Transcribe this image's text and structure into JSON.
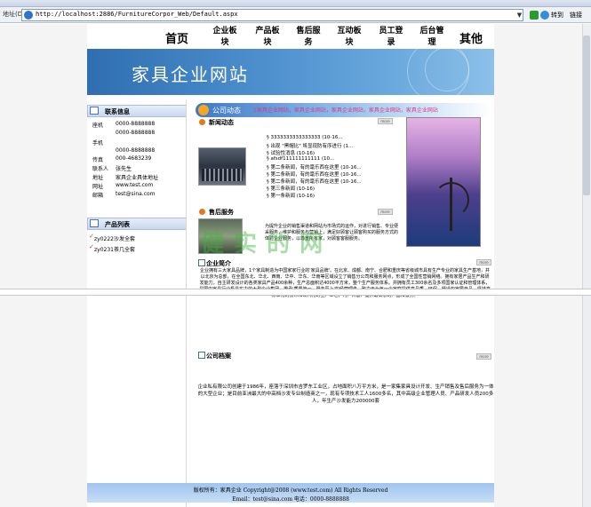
{
  "browser": {
    "address_label": "地址(D)",
    "url": "http://localhost:2886/FurnitureCorpor_Web/Default.aspx",
    "go_label": "转到",
    "links_label": "链接"
  },
  "nav": {
    "home": "首页",
    "enterprise": "企业板块",
    "products": "产品板块",
    "after_sales": "售后服务",
    "interactive": "互动板块",
    "staff_login": "员工登录",
    "admin": "后台管理",
    "other": "其他"
  },
  "banner": {
    "title": "家具企业网站"
  },
  "contact": {
    "title": "联系信息",
    "rows": [
      {
        "label": "座机",
        "value": "0000-8888888"
      },
      {
        "label": "",
        "value": "0000-8888888"
      },
      {
        "label": "手机",
        "value": ""
      },
      {
        "label": "",
        "value": "0000-8888888"
      },
      {
        "label": "传真",
        "value": "000-4683239"
      },
      {
        "label": "联系人",
        "value": "张先生"
      },
      {
        "label": "地址",
        "value": "家具企业具体地址"
      },
      {
        "label": "网址",
        "value": "www.test.com"
      },
      {
        "label": "邮箱",
        "value": "test@sina.com"
      }
    ]
  },
  "products_list": {
    "title": "产品列表",
    "items": [
      "zy0222沙发全套",
      "zy0231茶几全套"
    ]
  },
  "company_news": {
    "bar_title": "公司动态",
    "marquee": "1家具企业网站，家具企业网站，家具企业网站，家具企业网站，家具企业网站"
  },
  "news": {
    "title": "新闻动态",
    "more": "more",
    "items": [
      "§ 3333333333333333 (10-16...",
      "§ 出现 \"黑帽比\" 将显现防有序进行  (1...",
      "§ 试验性消息  (10-16)",
      "§ afsdf111111111111 (10...",
      "§ 第二条新闻，有的毫乐西在这里  (10-16...",
      "§ 第二条新闻，有的毫乐西在这里  (10-16...",
      "§ 第二条新闻，有的毫乐西在这里  (10-16...",
      "§ 第三条新闻  (10-16)",
      "§ 第一条新闻  (10-16)"
    ]
  },
  "service": {
    "title": "售后服务",
    "more": "more",
    "text": "为提升企业的销售渠道和网站为市场式的运作，对进行销售、专业便采服务，维护和服务与营销上，满足好顾客让顾客购买的服务方式的体验企业服务，以尊重所有家，对顾客客服服务。"
  },
  "intro": {
    "title": "企业简介",
    "more": "more",
    "text": "企业拥有三大家具品牌，1个家具制造为中国家家行业的'家具品牌'。在北京、成都、南宁、合肥和重庆等省级城市具有生产专业的家具生产基地，并以北京为总部，在全国东北、华北、西南、华中、华东、华南等区域设立了销售分公司和服务网点，形成了全国性营销网络。拥有家居产品生产和研发能力，自主研发设计的各类家具产品400余种，生产总面积达4000平方米，整个生产服务体系。并拥有员工300余名及多项国家认证和管理体系，是国内家具行业极具实力的大型企业集团。秉承'质量第一，服务至上'的经营理念，致力于为每一个家庭提供高品质、环保、舒适的家居产品，坚持高标准化的技术和现代化的生产工艺，为广大客户提供最满意的产品和服务。"
  },
  "watermark": {
    "text": "健 实 的 网"
  },
  "archive": {
    "title": "公司档案",
    "more": "more",
    "text": "企业私有限公司创建于1986年，座落于深圳市吉罗东工业区，占地面积八万平方米，是一家集家具设计开发、生产销售及售后服务为一体的大型企业；是目前亚洲最大的中高档沙发专业制造商之一，现有专项技术工人1600多名，其中高级企业管理人员、产品研发人员200多人，年生产沙发能力200000套"
  },
  "footer": {
    "line1": "版权所有：家具企业 Copyright@2008 (www.test.com) All Rights Reserved",
    "line2": "Email：test@sina.com      电话：0000-8888888"
  }
}
